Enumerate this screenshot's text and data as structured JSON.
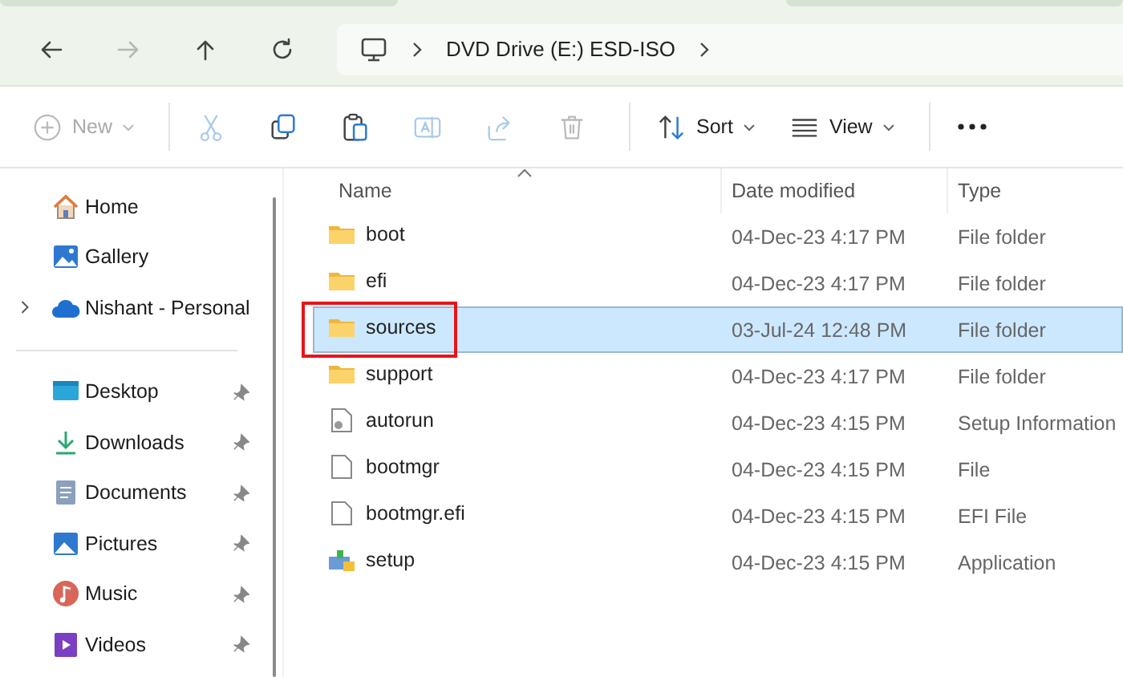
{
  "navigation": [
    {
      "kind": "back",
      "disabled": false
    },
    {
      "kind": "forward",
      "disabled": true
    },
    {
      "kind": "up",
      "disabled": false
    },
    {
      "kind": "refresh",
      "disabled": false
    }
  ],
  "address_bar": {
    "path": "DVD Drive (E:) ESD-ISO"
  },
  "toolbar": [
    {
      "kind": "new",
      "label": "New",
      "disabled": true
    },
    {
      "kind": "cut",
      "disabled": true
    },
    {
      "kind": "copy",
      "disabled": false
    },
    {
      "kind": "paste",
      "disabled": false
    },
    {
      "kind": "rename",
      "disabled": true
    },
    {
      "kind": "share",
      "disabled": true
    },
    {
      "kind": "delete",
      "disabled": true
    },
    {
      "kind": "sort",
      "label": "Sort",
      "disabled": false
    },
    {
      "kind": "view",
      "label": "View",
      "disabled": false
    },
    {
      "kind": "more"
    }
  ],
  "sidebar": {
    "groups": [
      [
        {
          "kind": "home",
          "label": "Home",
          "pinned": false,
          "expandable": false
        },
        {
          "kind": "gallery",
          "label": "Gallery",
          "pinned": false,
          "expandable": false
        },
        {
          "kind": "cloud",
          "label": "Nishant - Personal",
          "pinned": false,
          "expandable": true
        }
      ],
      [
        {
          "kind": "desktop",
          "label": "Desktop",
          "pinned": true,
          "expandable": false
        },
        {
          "kind": "downloads",
          "label": "Downloads",
          "pinned": true,
          "expandable": false
        },
        {
          "kind": "documents",
          "label": "Documents",
          "pinned": true,
          "expandable": false
        },
        {
          "kind": "pictures",
          "label": "Pictures",
          "pinned": true,
          "expandable": false
        },
        {
          "kind": "music",
          "label": "Music",
          "pinned": true,
          "expandable": false
        },
        {
          "kind": "videos",
          "label": "Videos",
          "pinned": true,
          "expandable": false
        }
      ]
    ]
  },
  "table": {
    "columns": [
      "Name",
      "Date modified",
      "Type"
    ],
    "rows": [
      {
        "kind": "folder",
        "name": "boot",
        "date": "04-Dec-23 4:17 PM",
        "type": "File folder",
        "selected": false,
        "highlighted": false
      },
      {
        "kind": "folder",
        "name": "efi",
        "date": "04-Dec-23 4:17 PM",
        "type": "File folder",
        "selected": false,
        "highlighted": false
      },
      {
        "kind": "folder",
        "name": "sources",
        "date": "03-Jul-24 12:48 PM",
        "type": "File folder",
        "selected": true,
        "highlighted": true
      },
      {
        "kind": "folder",
        "name": "support",
        "date": "04-Dec-23 4:17 PM",
        "type": "File folder",
        "selected": false,
        "highlighted": false
      },
      {
        "kind": "settings",
        "name": "autorun",
        "date": "04-Dec-23 4:15 PM",
        "type": "Setup Information",
        "selected": false,
        "highlighted": false
      },
      {
        "kind": "file",
        "name": "bootmgr",
        "date": "04-Dec-23 4:15 PM",
        "type": "File",
        "selected": false,
        "highlighted": false
      },
      {
        "kind": "file",
        "name": "bootmgr.efi",
        "date": "04-Dec-23 4:15 PM",
        "type": "EFI File",
        "selected": false,
        "highlighted": false
      },
      {
        "kind": "setup",
        "name": "setup",
        "date": "04-Dec-23 4:15 PM",
        "type": "Application",
        "selected": false,
        "highlighted": false
      }
    ]
  }
}
